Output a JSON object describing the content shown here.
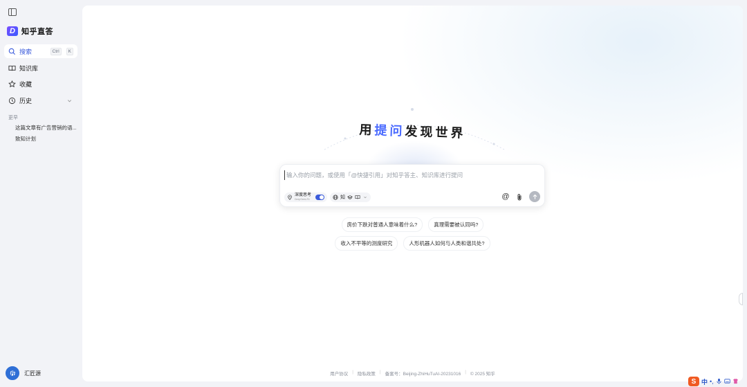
{
  "sidebar": {
    "brand": {
      "logo_letter": "D",
      "name": "知乎直答"
    },
    "search": {
      "label": "搜索",
      "shortcut_ctrl": "Ctrl",
      "shortcut_key": "K"
    },
    "nav": [
      {
        "label": "知识库",
        "icon": "book-icon"
      },
      {
        "label": "收藏",
        "icon": "star-icon"
      },
      {
        "label": "历史",
        "icon": "clock-icon"
      }
    ],
    "history": {
      "heading": "更早",
      "items": [
        "这篇文章有广告营销的语...",
        "致知计划"
      ]
    },
    "user": {
      "avatar_letter": "匠",
      "name": "汇匠源"
    }
  },
  "main": {
    "hero": {
      "prefix": "用",
      "accent": "提问",
      "suffix": "发现世界"
    },
    "composer": {
      "placeholder": "输入你的问题，或使用「@快捷引用」对知乎答主、知识库进行提问",
      "deep_think_label": "深度思考",
      "deep_think_sub": "DeepSeek-R1",
      "sources_zhi": "知"
    },
    "suggestions": [
      [
        "房价下跌对普通人意味着什么?",
        "真理需要被认同吗?"
      ],
      [
        "收入不平等的测度研究",
        "人形机器人如何与人类和谐共处?"
      ]
    ],
    "footer": [
      "用户协议",
      "隐私政策",
      "备案号：Beijing-ZhiHuTuAI-20231016",
      "© 2025 知乎"
    ]
  },
  "ime": {
    "logo": "S",
    "lang": "中"
  },
  "colors": {
    "accent": "#4b6bff",
    "send_disabled": "#b5b9c1",
    "panel_bg": "#ffffff",
    "app_bg": "#f2f3f7"
  }
}
